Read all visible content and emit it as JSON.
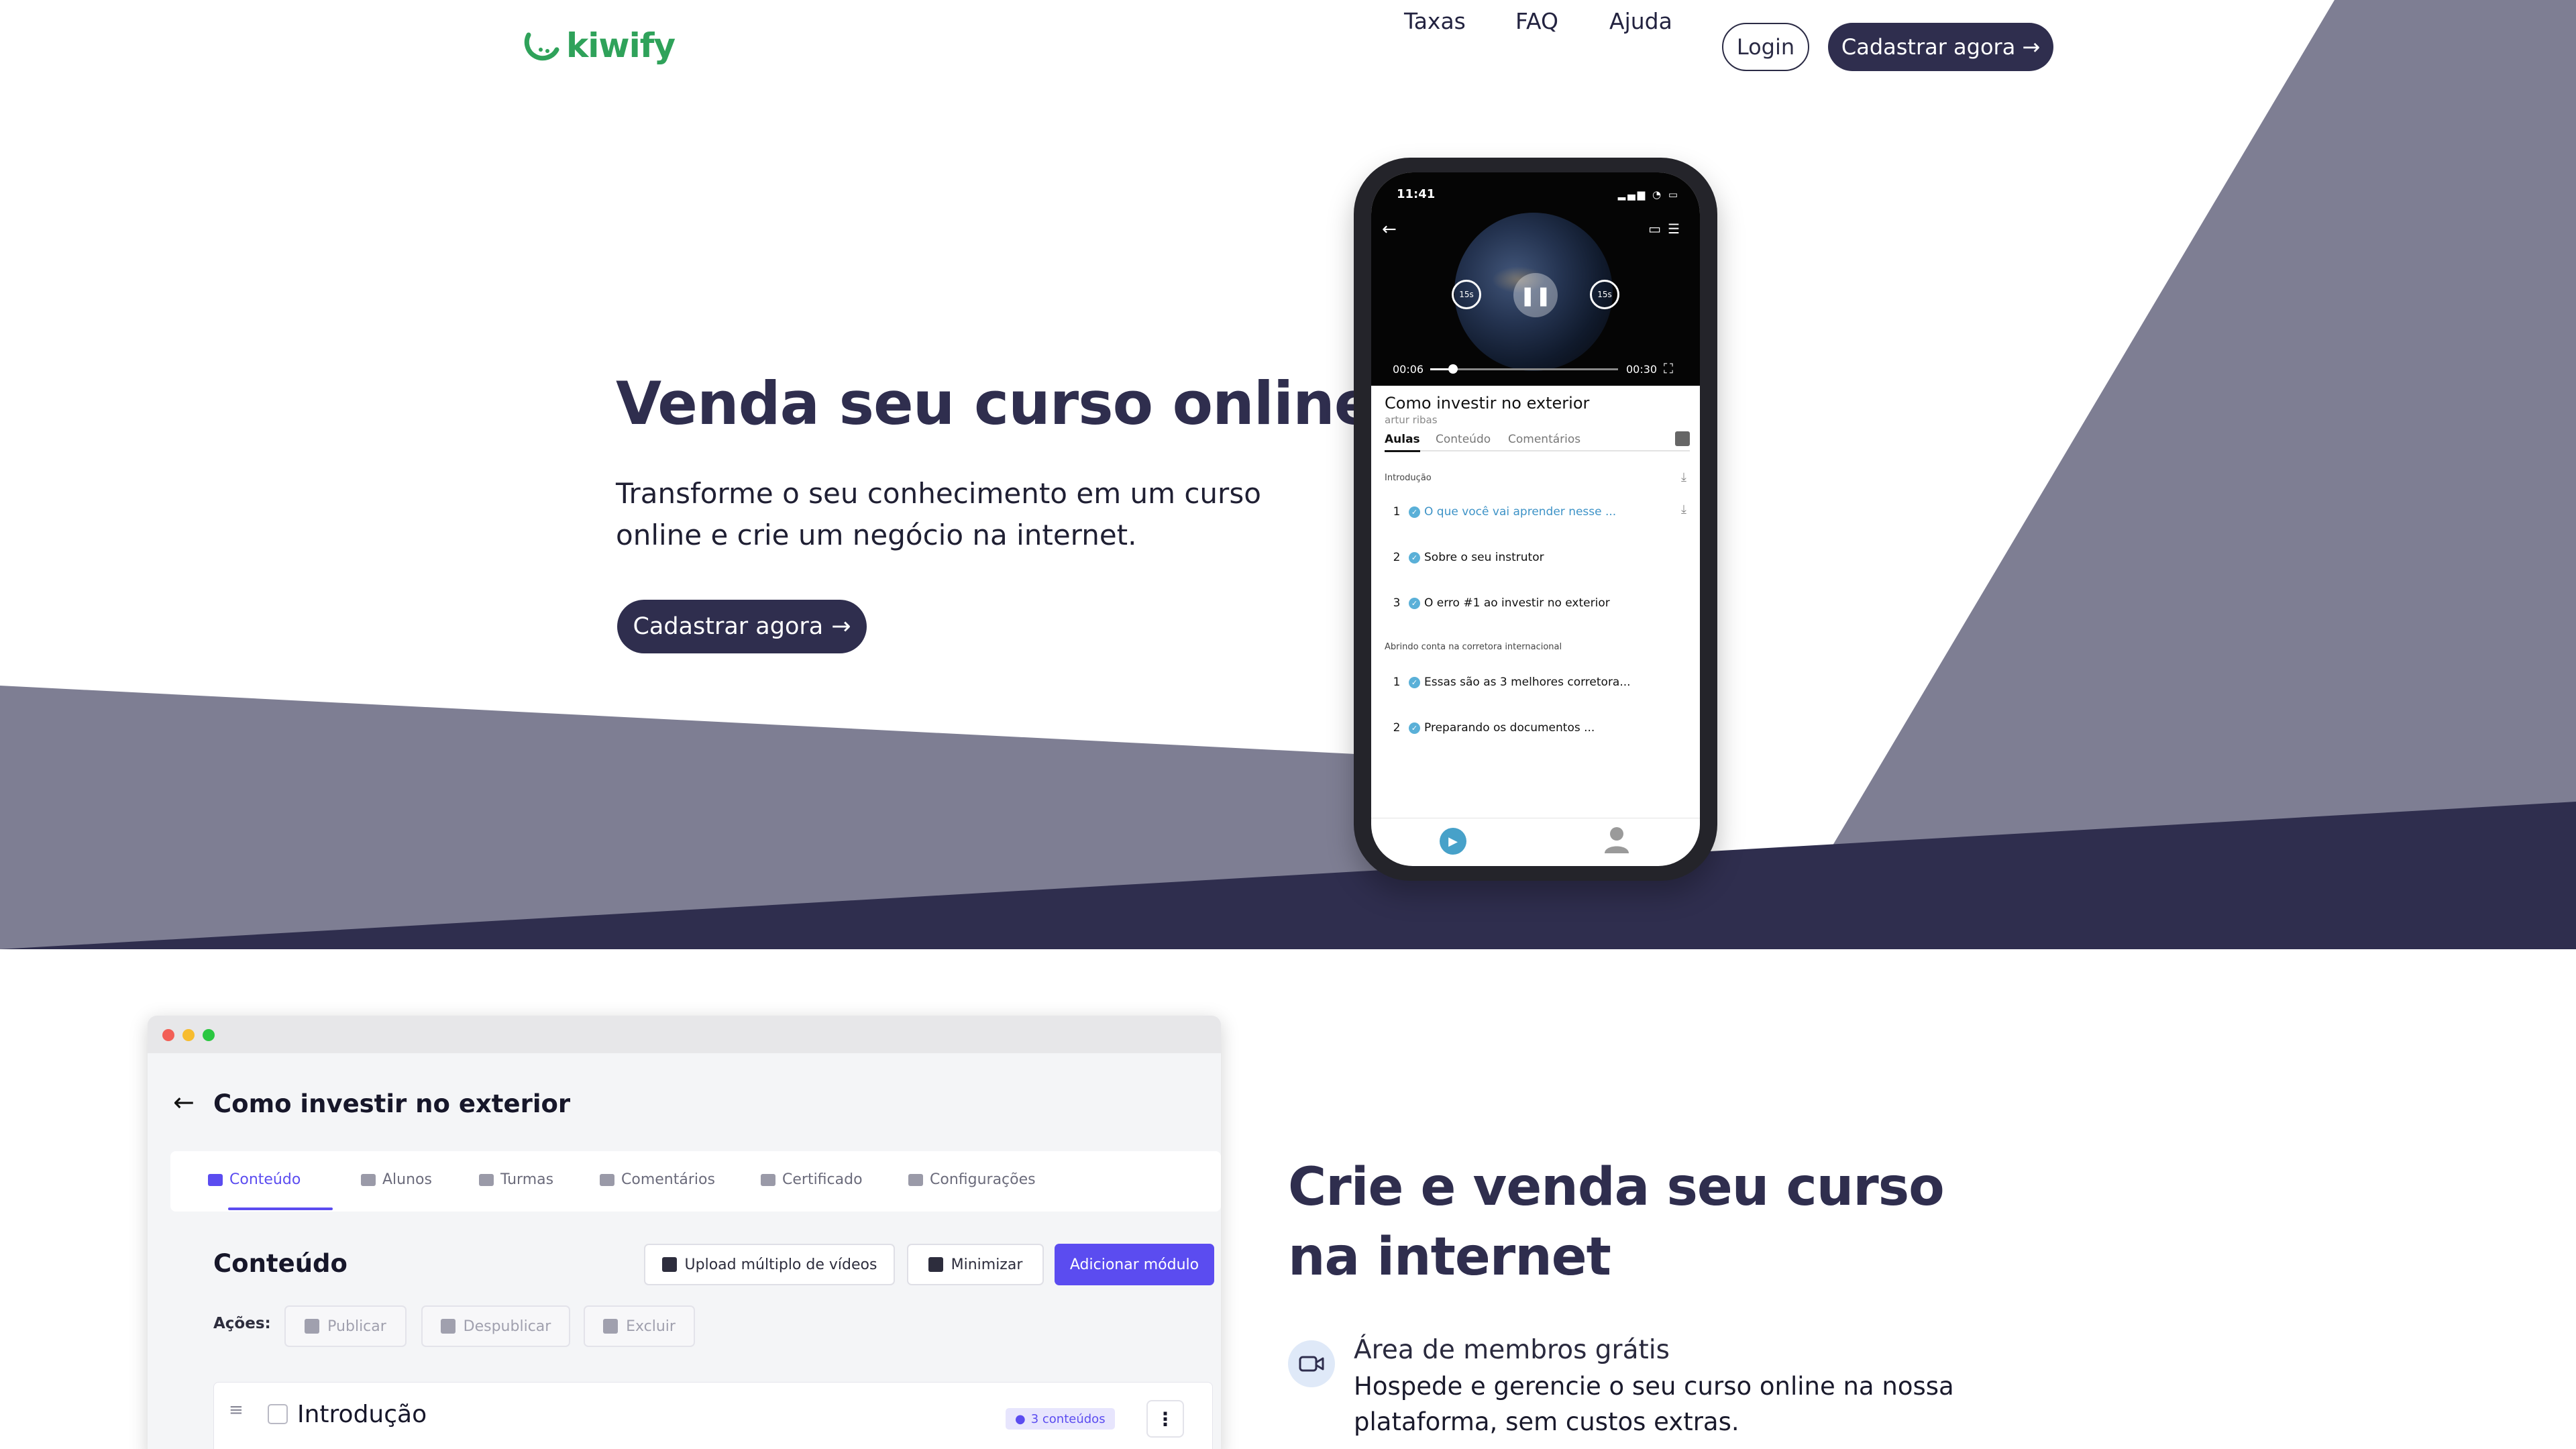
{
  "nav": {
    "logo": "kiwify",
    "links": [
      "Taxas",
      "FAQ",
      "Ajuda"
    ],
    "login": "Login",
    "cta": "Cadastrar agora",
    "arrow": "→"
  },
  "hero": {
    "title": "Venda seu curso online",
    "subtitle": "Transforme o seu conhecimento em um curso online e crie um negócio na internet.",
    "cta": "Cadastrar agora",
    "arrow": "→"
  },
  "phone": {
    "status_time": "11:41",
    "status_icons": "▂▄▆ ◔ ▭",
    "video": {
      "current": "00:06",
      "end": "00:30",
      "progress": 0.12,
      "skip_back": "15s",
      "skip_fwd": "15s",
      "pause": "❚❚",
      "back": "←",
      "tools": "▭☰",
      "fullscreen": "⛶"
    },
    "lesson_title": "Como investir no exterior",
    "author": "artur ribas",
    "tabs": [
      "Aulas",
      "Conteúdo",
      "Comentários"
    ],
    "sections": [
      {
        "label": "Introdução",
        "lessons": [
          {
            "num": "1",
            "name": "O que você vai aprender nesse ..."
          },
          {
            "num": "2",
            "name": "Sobre o seu instrutor"
          },
          {
            "num": "3",
            "name": "O erro #1 ao investir no exterior"
          }
        ]
      },
      {
        "label": "Abrindo conta na corretora internacional",
        "lessons": [
          {
            "num": "1",
            "name": "Essas são as 3 melhores corretora..."
          },
          {
            "num": "2",
            "name": "Preparando os documentos ..."
          }
        ]
      }
    ],
    "check": "✓",
    "download": "⤓",
    "play": "▶"
  },
  "app": {
    "back": "←",
    "title": "Como investir no exterior",
    "tabs": [
      "Conteúdo",
      "Alunos",
      "Turmas",
      "Comentários",
      "Certificado",
      "Configurações"
    ],
    "content_title": "Conteúdo",
    "buttons": {
      "upload": "Upload múltiplo de vídeos",
      "minimize": "Minimizar",
      "add_module": "Adicionar módulo"
    },
    "actions_label": "Ações:",
    "actions": [
      "Publicar",
      "Despublicar",
      "Excluir"
    ],
    "module": {
      "drag": "≡",
      "name": "Introdução",
      "badge": "3 conteúdos",
      "badge_dot": "●",
      "more": "⋮"
    }
  },
  "feature": {
    "title": "Crie e venda seu curso na internet",
    "item_name": "Área de membros grátis",
    "item_desc": "Hospede e gerencie o seu curso online na nossa plataforma, sem custos extras."
  },
  "colors": {
    "brand_green": "#2fa25a",
    "navy": "#2f2e4e",
    "gray_shape": "#7e7e93",
    "accent_purple": "#5b4cf0",
    "player_blue": "#47a1c9"
  }
}
